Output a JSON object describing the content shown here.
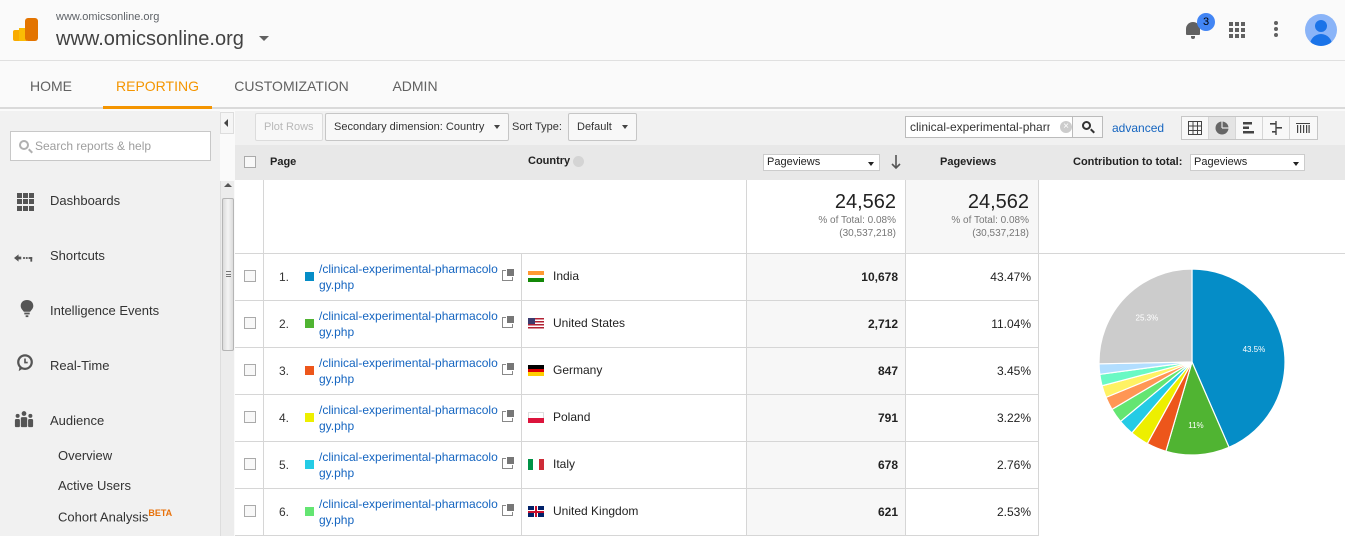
{
  "header": {
    "account_small": "www.omicsonline.org",
    "account_big": "www.omicsonline.org",
    "notification_count": "3",
    "icons": [
      "analytics-logo-icon",
      "bell-icon",
      "apps-grid-icon",
      "more-vert-icon",
      "avatar-icon"
    ]
  },
  "nav": {
    "tabs": [
      {
        "label": "HOME",
        "active": false
      },
      {
        "label": "REPORTING",
        "active": true
      },
      {
        "label": "CUSTOMIZATION",
        "active": false
      },
      {
        "label": "ADMIN",
        "active": false
      }
    ],
    "accent_color": "#f49500"
  },
  "sidebar": {
    "search_placeholder": "Search reports & help",
    "items": [
      {
        "label": "Dashboards",
        "icon": "dashboard-grid-icon"
      },
      {
        "label": "Shortcuts",
        "icon": "shortcut-arrow-icon"
      },
      {
        "label": "Intelligence Events",
        "icon": "lightbulb-icon"
      },
      {
        "label": "Real-Time",
        "icon": "clock-bubble-icon"
      },
      {
        "label": "Audience",
        "icon": "people-icon"
      }
    ],
    "subitems": [
      {
        "label": "Overview"
      },
      {
        "label": "Active Users"
      },
      {
        "label": "Cohort Analysis",
        "badge": "BETA"
      }
    ]
  },
  "toolbar": {
    "plot_rows": "Plot Rows",
    "secondary_dimension": "Secondary dimension: Country",
    "sort_type_label": "Sort Type:",
    "sort_type_value": "Default",
    "filter_value": "clinical-experimental-pharm",
    "advanced_label": "advanced",
    "view_icons": [
      "table-view-icon",
      "pie-view-icon",
      "bar-view-icon",
      "comparison-view-icon",
      "pivot-view-icon"
    ]
  },
  "table": {
    "headers": {
      "page": "Page",
      "country": "Country",
      "metric_select": "Pageviews",
      "pageviews": "Pageviews",
      "contribution_label": "Contribution to total:",
      "contribution_select": "Pageviews"
    },
    "totals": {
      "value_1": "24,562",
      "pct_1": "% of Total: 0.08%",
      "total_1": "(30,537,218)",
      "value_2": "24,562",
      "pct_2": "% of Total: 0.08%",
      "total_2": "(30,537,218)"
    },
    "rows": [
      {
        "num": "1.",
        "page": "/clinical-experimental-pharmacology.php",
        "country": "India",
        "pageviews": "10,678",
        "percent": "43.47%",
        "color": "#058dc7"
      },
      {
        "num": "2.",
        "page": "/clinical-experimental-pharmacology.php",
        "country": "United States",
        "pageviews": "2,712",
        "percent": "11.04%",
        "color": "#50b432"
      },
      {
        "num": "3.",
        "page": "/clinical-experimental-pharmacology.php",
        "country": "Germany",
        "pageviews": "847",
        "percent": "3.45%",
        "color": "#ed561b"
      },
      {
        "num": "4.",
        "page": "/clinical-experimental-pharmacology.php",
        "country": "Poland",
        "pageviews": "791",
        "percent": "3.22%",
        "color": "#edef00"
      },
      {
        "num": "5.",
        "page": "/clinical-experimental-pharmacology.php",
        "country": "Italy",
        "pageviews": "678",
        "percent": "2.76%",
        "color": "#24cbe5"
      },
      {
        "num": "6.",
        "page": "/clinical-experimental-pharmacology.php",
        "country": "United Kingdom",
        "pageviews": "621",
        "percent": "2.53%",
        "color": "#64e572"
      }
    ]
  },
  "chart_data": {
    "type": "pie",
    "title": "Contribution to total: Pageviews",
    "slices": [
      {
        "label": "India",
        "value": 43.47,
        "color": "#058dc7",
        "data_label": "43.5%"
      },
      {
        "label": "United States",
        "value": 11.04,
        "color": "#50b432",
        "data_label": "11%"
      },
      {
        "label": "Germany",
        "value": 3.45,
        "color": "#ed561b",
        "data_label": ""
      },
      {
        "label": "Poland",
        "value": 3.22,
        "color": "#edef00",
        "data_label": ""
      },
      {
        "label": "Italy",
        "value": 2.76,
        "color": "#24cbe5",
        "data_label": ""
      },
      {
        "label": "United Kingdom",
        "value": 2.53,
        "color": "#64e572",
        "data_label": ""
      },
      {
        "label": "Row 7",
        "value": 2.3,
        "color": "#ff9655",
        "data_label": ""
      },
      {
        "label": "Row 8",
        "value": 2.1,
        "color": "#fff263",
        "data_label": ""
      },
      {
        "label": "Row 9",
        "value": 2.0,
        "color": "#6af9c4",
        "data_label": ""
      },
      {
        "label": "Row 10",
        "value": 1.8,
        "color": "#b2deff",
        "data_label": ""
      },
      {
        "label": "Other",
        "value": 25.3,
        "color": "#cccccc",
        "data_label": "25.3%"
      }
    ]
  }
}
